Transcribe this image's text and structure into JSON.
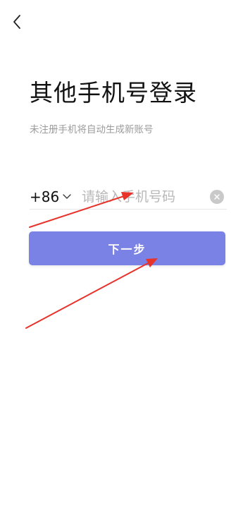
{
  "header": {
    "back_icon": "chevron-left-icon"
  },
  "main": {
    "title": "其他手机号登录",
    "subtitle": "未注册手机将自动生成新账号",
    "phone": {
      "country_code": "+86",
      "placeholder": "请输入手机号码",
      "value": "",
      "dropdown_icon": "chevron-down-icon",
      "clear_icon": "close-icon"
    },
    "next_button": {
      "label": "下一步",
      "color": "#7b82e6"
    }
  },
  "annotations": {
    "arrow_color": "#e8332b"
  }
}
